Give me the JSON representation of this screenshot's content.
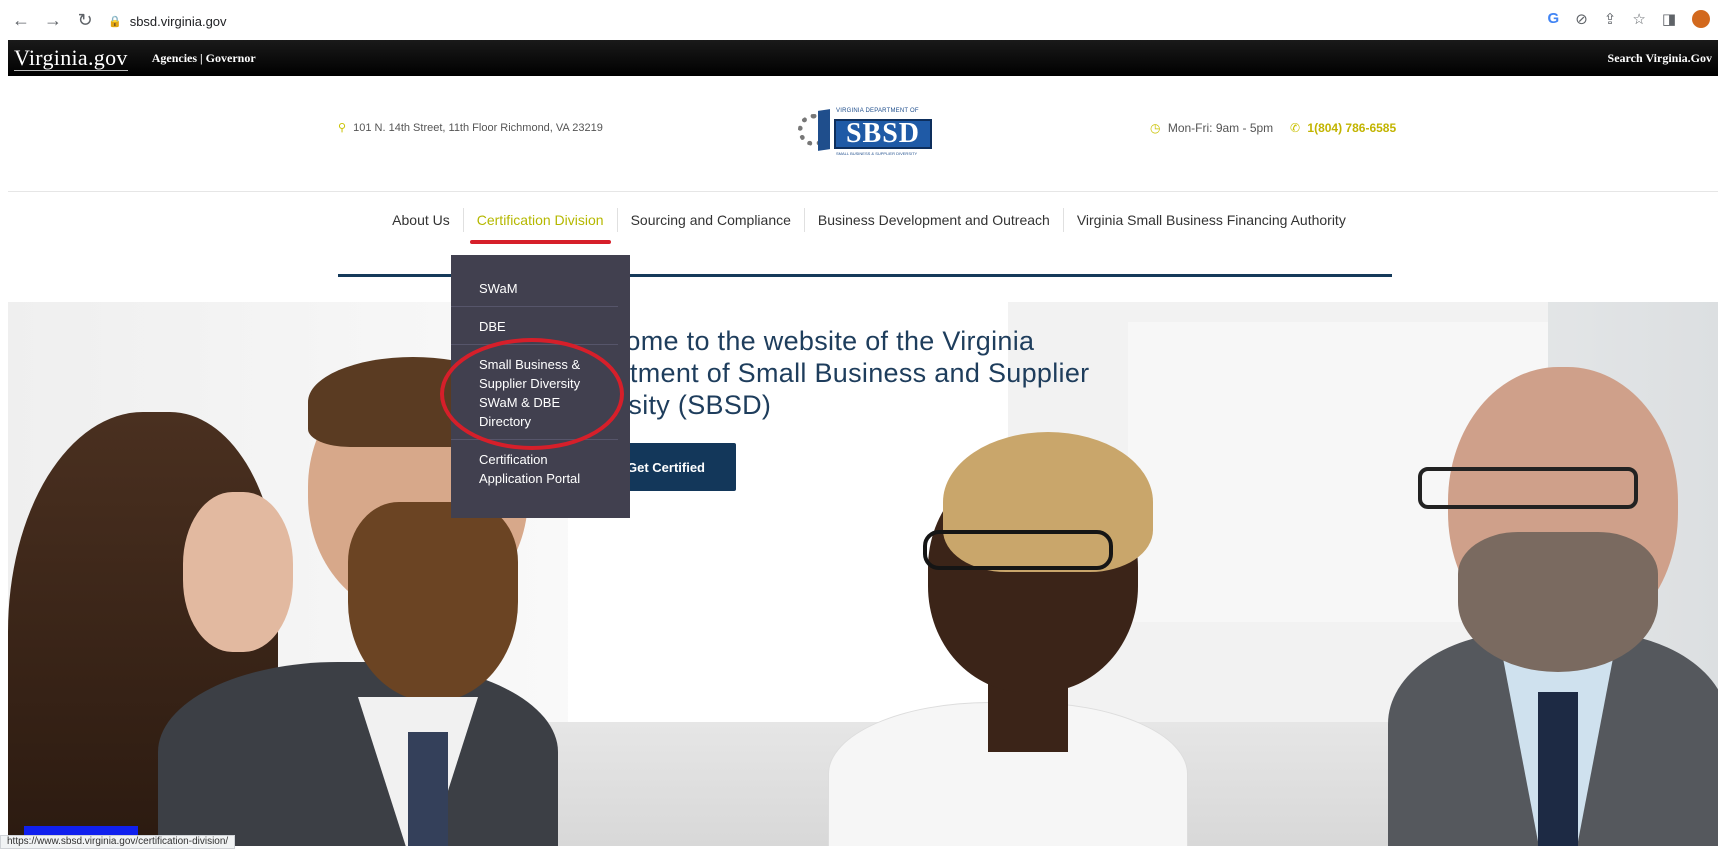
{
  "browser": {
    "url": "sbsd.virginia.gov",
    "status_url": "https://www.sbsd.virginia.gov/certification-division/"
  },
  "va_bar": {
    "logo": "Virginia.gov",
    "links": "Agencies | Governor",
    "search": "Search Virginia.Gov"
  },
  "header": {
    "address": "101 N. 14th Street, 11th Floor Richmond, VA 23219",
    "hours": "Mon-Fri: 9am - 5pm",
    "phone": "1(804) 786-6585",
    "logo_top": "VIRGINIA DEPARTMENT OF",
    "logo_main": "SBSD",
    "logo_bottom": "SMALL BUSINESS & SUPPLIER DIVERSITY"
  },
  "nav": {
    "items": [
      {
        "label": "About Us"
      },
      {
        "label": "Certification Division"
      },
      {
        "label": "Sourcing and Compliance"
      },
      {
        "label": "Business Development and Outreach"
      },
      {
        "label": "Virginia Small Business Financing Authority"
      }
    ],
    "active_color": "#b5b800",
    "underline_color": "#d61f2a"
  },
  "dropdown": {
    "items": [
      {
        "label": "SWaM"
      },
      {
        "label": "DBE"
      },
      {
        "label": "Small Business & Supplier Diversity SWaM & DBE Directory"
      },
      {
        "label": "Certification Application Portal"
      }
    ],
    "background": "#41404f"
  },
  "hero": {
    "title": "elcome to the website of the Virginia partment of Small Business and Supplier versity (SBSD)",
    "button": "Get Certified"
  },
  "colors": {
    "navy": "#13375a",
    "annotation": "#d61f2a"
  }
}
